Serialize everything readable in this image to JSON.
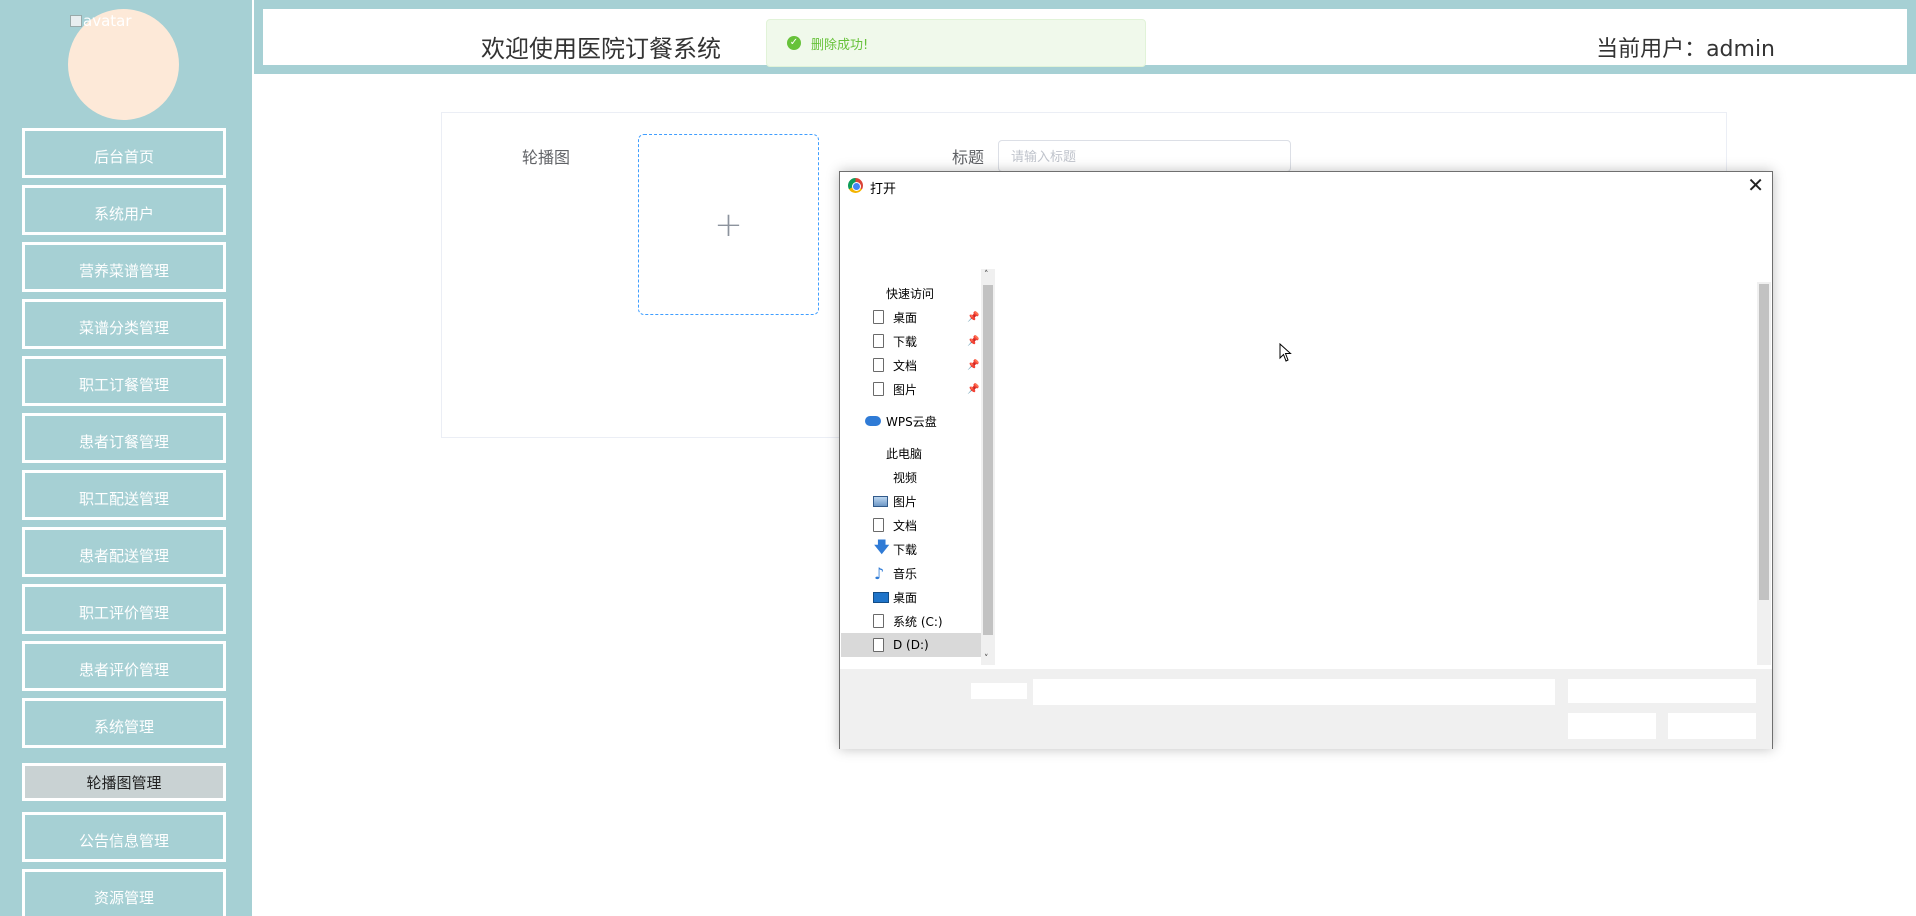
{
  "sidebar": {
    "avatar_alt": "avatar",
    "items": [
      {
        "label": "后台首页"
      },
      {
        "label": "系统用户"
      },
      {
        "label": "营养菜谱管理"
      },
      {
        "label": "菜谱分类管理"
      },
      {
        "label": "职工订餐管理"
      },
      {
        "label": "患者订餐管理"
      },
      {
        "label": "职工配送管理"
      },
      {
        "label": "患者配送管理"
      },
      {
        "label": "职工评价管理"
      },
      {
        "label": "患者评价管理"
      },
      {
        "label": "系统管理"
      },
      {
        "label": "轮播图管理",
        "active": true
      },
      {
        "label": "公告信息管理"
      },
      {
        "label": "资源管理"
      }
    ]
  },
  "header": {
    "title": "欢迎使用医院订餐系统",
    "user": "当前用户：admin"
  },
  "toast": {
    "message": "删除成功!",
    "icon": "success-check-icon"
  },
  "form": {
    "carousel_label": "轮播图",
    "upload_plus": "+",
    "title_label": "标题",
    "title_placeholder": "请输入标题",
    "title_value": ""
  },
  "dialog": {
    "title": "打开",
    "close": "✕",
    "nav": {
      "quick_access": "快速访问",
      "quick_items": [
        {
          "label": "桌面",
          "icon": "document-icon",
          "pinned": true
        },
        {
          "label": "下载",
          "icon": "document-icon",
          "pinned": true
        },
        {
          "label": "文档",
          "icon": "document-icon",
          "pinned": true
        },
        {
          "label": "图片",
          "icon": "document-icon",
          "pinned": true
        }
      ],
      "wps": "WPS云盘",
      "this_pc": "此电脑",
      "pc_items": [
        {
          "label": "视频",
          "icon": "none"
        },
        {
          "label": "图片",
          "icon": "pictures-icon"
        },
        {
          "label": "文档",
          "icon": "documents-icon"
        },
        {
          "label": "下载",
          "icon": "download-arrow-icon"
        },
        {
          "label": "音乐",
          "icon": "music-note-icon"
        },
        {
          "label": "桌面",
          "icon": "desktop-icon"
        },
        {
          "label": "系统 (C:)",
          "icon": "drive-icon"
        },
        {
          "label": "D (D:)",
          "icon": "drive-icon",
          "selected": true
        }
      ]
    },
    "scroll_up": "˄",
    "scroll_down": "˅"
  },
  "colors": {
    "sidebar_bg": "#a6d0d4",
    "avatar_bg": "#fde9d8",
    "toast_green": "#67c23a",
    "upload_border": "#409eff"
  }
}
